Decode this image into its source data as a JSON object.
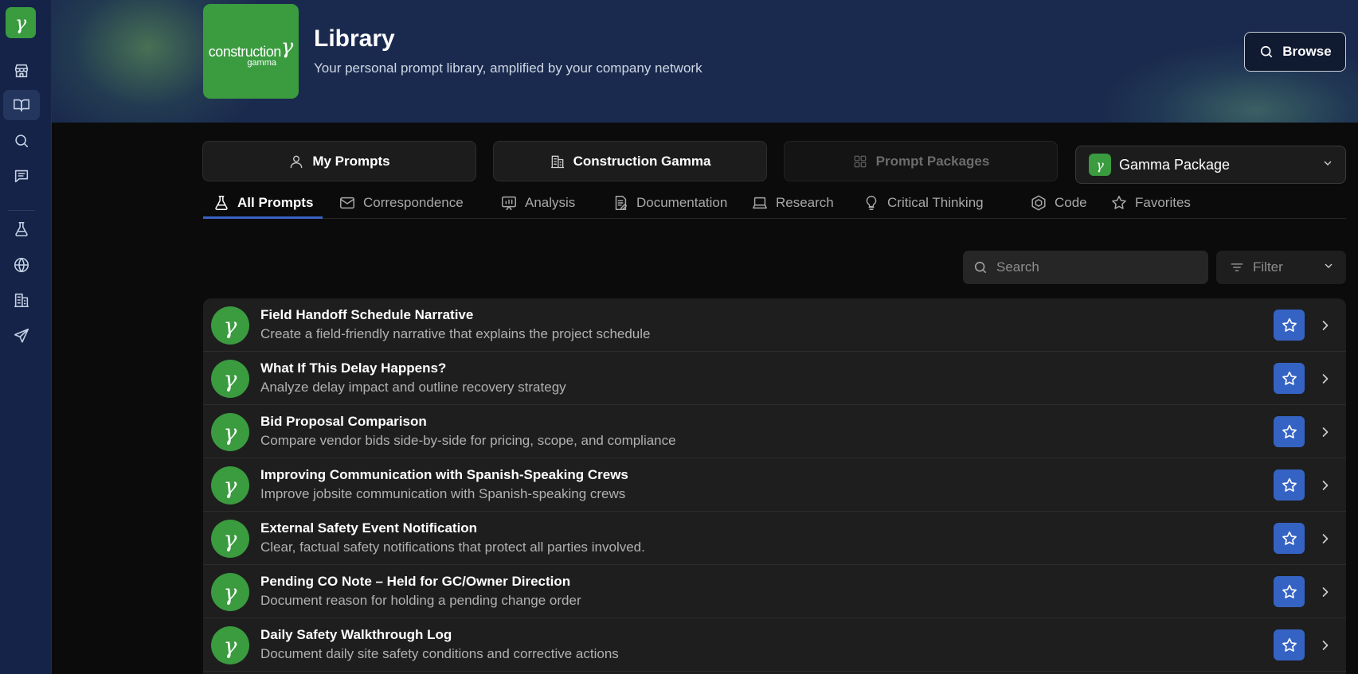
{
  "sidebar": {
    "logo_glyph": "γ",
    "items": [
      {
        "icon": "store-icon"
      },
      {
        "icon": "book-open-icon",
        "active": true
      },
      {
        "icon": "search-icon"
      },
      {
        "icon": "chat-icon"
      },
      {
        "icon": "flask-icon"
      },
      {
        "icon": "globe-icon"
      },
      {
        "icon": "building-icon"
      },
      {
        "icon": "send-icon"
      }
    ]
  },
  "header": {
    "brand_word": "construction",
    "brand_glyph": "γ",
    "brand_sub": "gamma",
    "title": "Library",
    "subtitle": "Your personal prompt library, amplified by your company network",
    "browse_label": "Browse"
  },
  "segments": {
    "my_prompts": "My Prompts",
    "company": "Construction Gamma",
    "packages": "Prompt Packages"
  },
  "package_select": {
    "glyph": "γ",
    "value": "Gamma Package"
  },
  "tabs": [
    {
      "label": "All Prompts",
      "icon": "flask-icon",
      "active": true
    },
    {
      "label": "Correspondence",
      "icon": "mail-icon"
    },
    {
      "label": "Analysis",
      "icon": "chart-icon"
    },
    {
      "label": "Documentation",
      "icon": "document-icon"
    },
    {
      "label": "Research",
      "icon": "laptop-icon"
    },
    {
      "label": "Critical Thinking",
      "icon": "lightbulb-icon"
    },
    {
      "label": "Code",
      "icon": "cube-icon"
    },
    {
      "label": "Favorites",
      "icon": "star-icon"
    }
  ],
  "search": {
    "placeholder": "Search"
  },
  "filter": {
    "label": "Filter"
  },
  "prompts": [
    {
      "glyph": "γ",
      "title": "Field Handoff Schedule Narrative",
      "description": "Create a field-friendly narrative that explains the project schedule"
    },
    {
      "glyph": "γ",
      "title": "What If This Delay Happens?",
      "description": "Analyze delay impact and outline recovery strategy"
    },
    {
      "glyph": "γ",
      "title": "Bid Proposal Comparison",
      "description": "Compare vendor bids side-by-side for pricing, scope, and compliance"
    },
    {
      "glyph": "γ",
      "title": "Improving Communication with Spanish-Speaking Crews",
      "description": "Improve jobsite communication with Spanish-speaking crews"
    },
    {
      "glyph": "γ",
      "title": "External Safety Event Notification",
      "description": "Clear, factual safety notifications that protect all parties involved."
    },
    {
      "glyph": "γ",
      "title": "Pending CO Note – Held for GC/Owner Direction",
      "description": "Document reason for holding a pending change order"
    },
    {
      "glyph": "γ",
      "title": "Daily Safety Walkthrough Log",
      "description": "Document daily site safety conditions and corrective actions"
    }
  ],
  "colors": {
    "brand_green": "#3a9b3f",
    "sidebar_navy": "#142347",
    "accent_blue": "#3563c4"
  }
}
